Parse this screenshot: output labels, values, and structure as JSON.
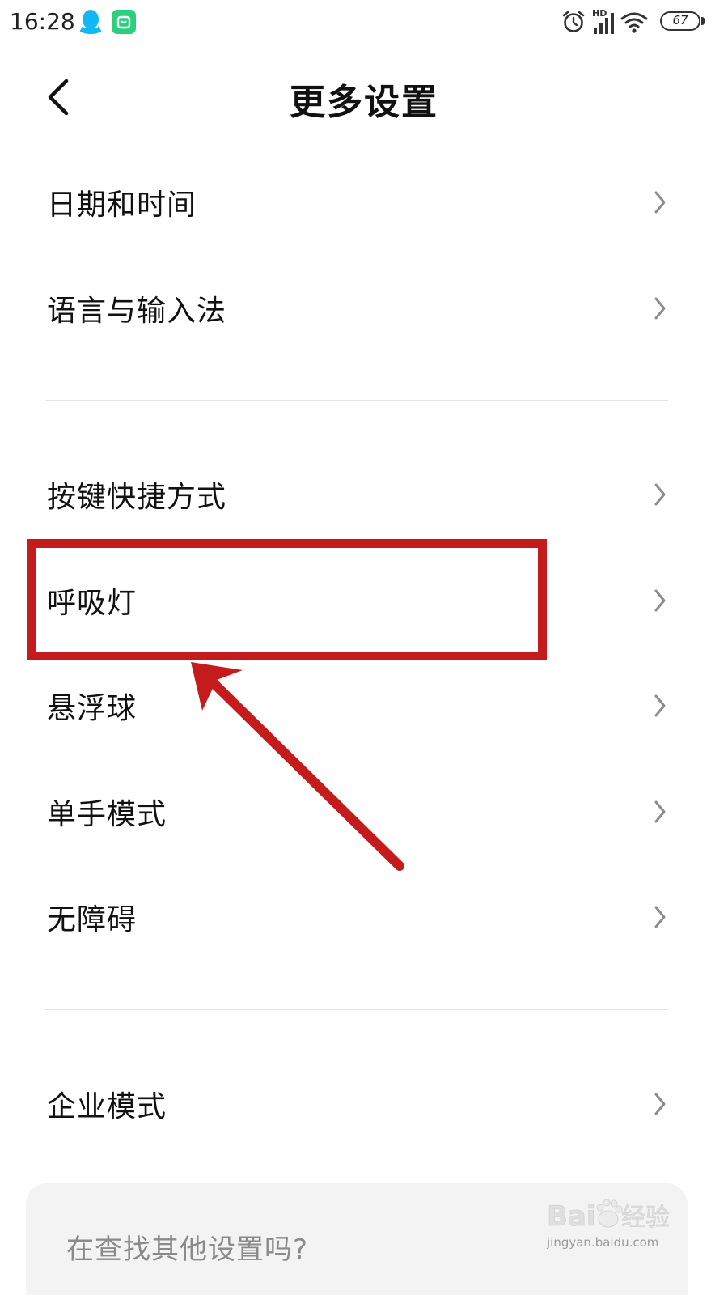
{
  "status_bar": {
    "time": "16:28",
    "hd_label": "HD",
    "battery_level": "67",
    "icons": [
      "qq-icon",
      "mi-home-icon",
      "alarm-icon",
      "signal-icon",
      "wifi-icon",
      "battery-icon"
    ]
  },
  "header": {
    "title": "更多设置",
    "back_icon": "chevron-left-icon"
  },
  "menu": {
    "items": [
      {
        "label": "日期和时间"
      },
      {
        "label": "语言与输入法"
      },
      {
        "label": "按键快捷方式"
      },
      {
        "label": "呼吸灯"
      },
      {
        "label": "悬浮球"
      },
      {
        "label": "单手模式"
      },
      {
        "label": "无障碍"
      },
      {
        "label": "企业模式"
      }
    ],
    "chevron_icon": "chevron-right-icon"
  },
  "search_card": {
    "text": "在查找其他设置吗?"
  },
  "annotation": {
    "color": "#c41c1c",
    "highlighted_item": "呼吸灯"
  },
  "watermark": {
    "brand": "Baidu经验",
    "url": "jingyan.baidu.com"
  }
}
